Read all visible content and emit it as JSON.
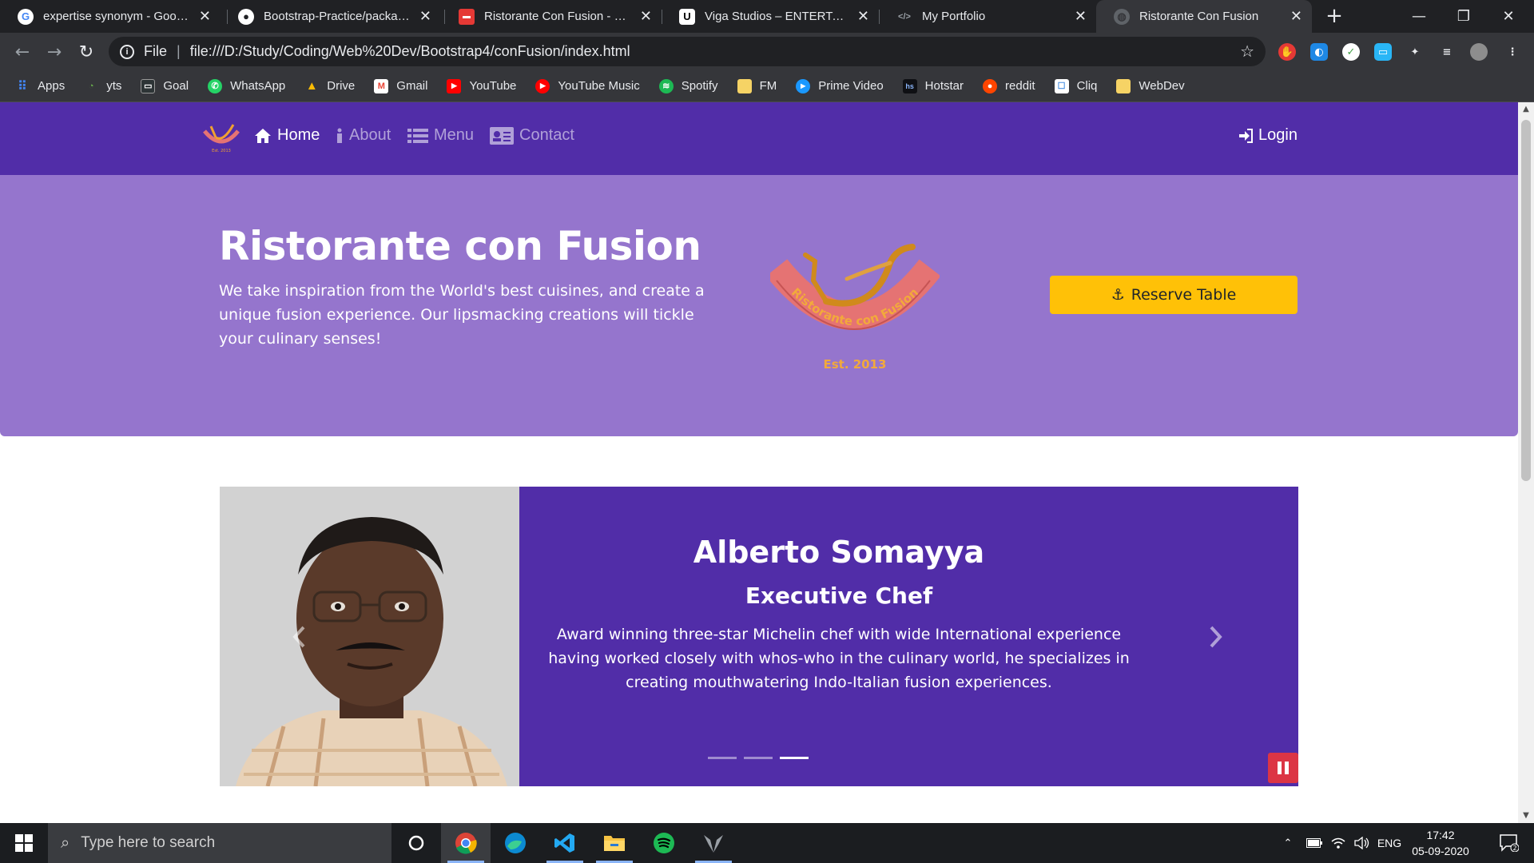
{
  "browser": {
    "tabs": [
      {
        "title": "expertise synonym - Google",
        "icon": "google-icon",
        "active": false
      },
      {
        "title": "Bootstrap-Practice/package.j",
        "icon": "github-icon",
        "active": false
      },
      {
        "title": "Ristorante Con Fusion - Goo",
        "icon": "slides-icon",
        "active": false
      },
      {
        "title": "Viga Studios – ENTERTAINM",
        "icon": "u-icon",
        "active": false
      },
      {
        "title": "My Portfolio",
        "icon": "code-icon",
        "active": false
      },
      {
        "title": "Ristorante Con Fusion",
        "icon": "globe-icon",
        "active": true
      }
    ],
    "address": {
      "scheme": "File",
      "url": "file:///D:/Study/Coding/Web%20Dev/Bootstrap4/conFusion/index.html"
    },
    "bookmarks": [
      {
        "label": "Apps",
        "icon": "apps-grid-icon",
        "color": "#4285f4"
      },
      {
        "label": "yts",
        "icon": "yts-icon",
        "color": "#6ab04c"
      },
      {
        "label": "Goal",
        "icon": "goal-icon",
        "color": "#2d3436"
      },
      {
        "label": "WhatsApp",
        "icon": "whatsapp-icon",
        "color": "#25d366"
      },
      {
        "label": "Drive",
        "icon": "drive-icon",
        "color": "#fbbc04"
      },
      {
        "label": "Gmail",
        "icon": "gmail-icon",
        "color": "#ea4335"
      },
      {
        "label": "YouTube",
        "icon": "youtube-icon",
        "color": "#ff0000"
      },
      {
        "label": "YouTube Music",
        "icon": "youtube-music-icon",
        "color": "#ff0000"
      },
      {
        "label": "Spotify",
        "icon": "spotify-icon",
        "color": "#1db954"
      },
      {
        "label": "FM",
        "icon": "folder-icon",
        "color": "#f6d365"
      },
      {
        "label": "Prime Video",
        "icon": "prime-video-icon",
        "color": "#1a98ff"
      },
      {
        "label": "Hotstar",
        "icon": "hotstar-icon",
        "color": "#0f1014"
      },
      {
        "label": "reddit",
        "icon": "reddit-icon",
        "color": "#ff4500"
      },
      {
        "label": "Cliq",
        "icon": "cliq-icon",
        "color": "#4a90e2"
      },
      {
        "label": "WebDev",
        "icon": "folder-icon",
        "color": "#f6d365"
      }
    ]
  },
  "site": {
    "nav": {
      "links": [
        {
          "label": "Home",
          "icon": "home-icon",
          "active": true
        },
        {
          "label": "About",
          "icon": "info-icon",
          "active": false
        },
        {
          "label": "Menu",
          "icon": "list-icon",
          "active": false
        },
        {
          "label": "Contact",
          "icon": "address-card-icon",
          "active": false
        }
      ],
      "login": "Login"
    },
    "jumbotron": {
      "title": "Ristorante con Fusion",
      "text": "We take inspiration from the World's best cuisines, and create a unique fusion experience. Our lipsmacking creations will tickle your culinary senses!",
      "logo_text": "Ristorante con Fusion",
      "logo_est": "Est. 2013",
      "reserve_label": "Reserve Table"
    },
    "carousel": {
      "name": "Alberto Somayya",
      "role": "Executive Chef",
      "description": "Award winning three-star Michelin chef with wide International experience having worked closely with whos-who in the culinary world, he specializes in creating mouthwatering Indo-Italian fusion experiences.",
      "slide_count": 3,
      "active_slide": 3
    }
  },
  "taskbar": {
    "search_placeholder": "Type here to search",
    "apps": [
      "cortana-icon",
      "chrome-icon",
      "edge-icon",
      "vscode-icon",
      "file-explorer-icon",
      "spotify-icon",
      "predator-icon"
    ],
    "language": "ENG",
    "time": "17:42",
    "date": "05-09-2020",
    "notifications": "2"
  },
  "colors": {
    "primary": "#512da8",
    "primary_light": "#9575cd",
    "warning": "#ffc107",
    "danger": "#dc3545"
  }
}
